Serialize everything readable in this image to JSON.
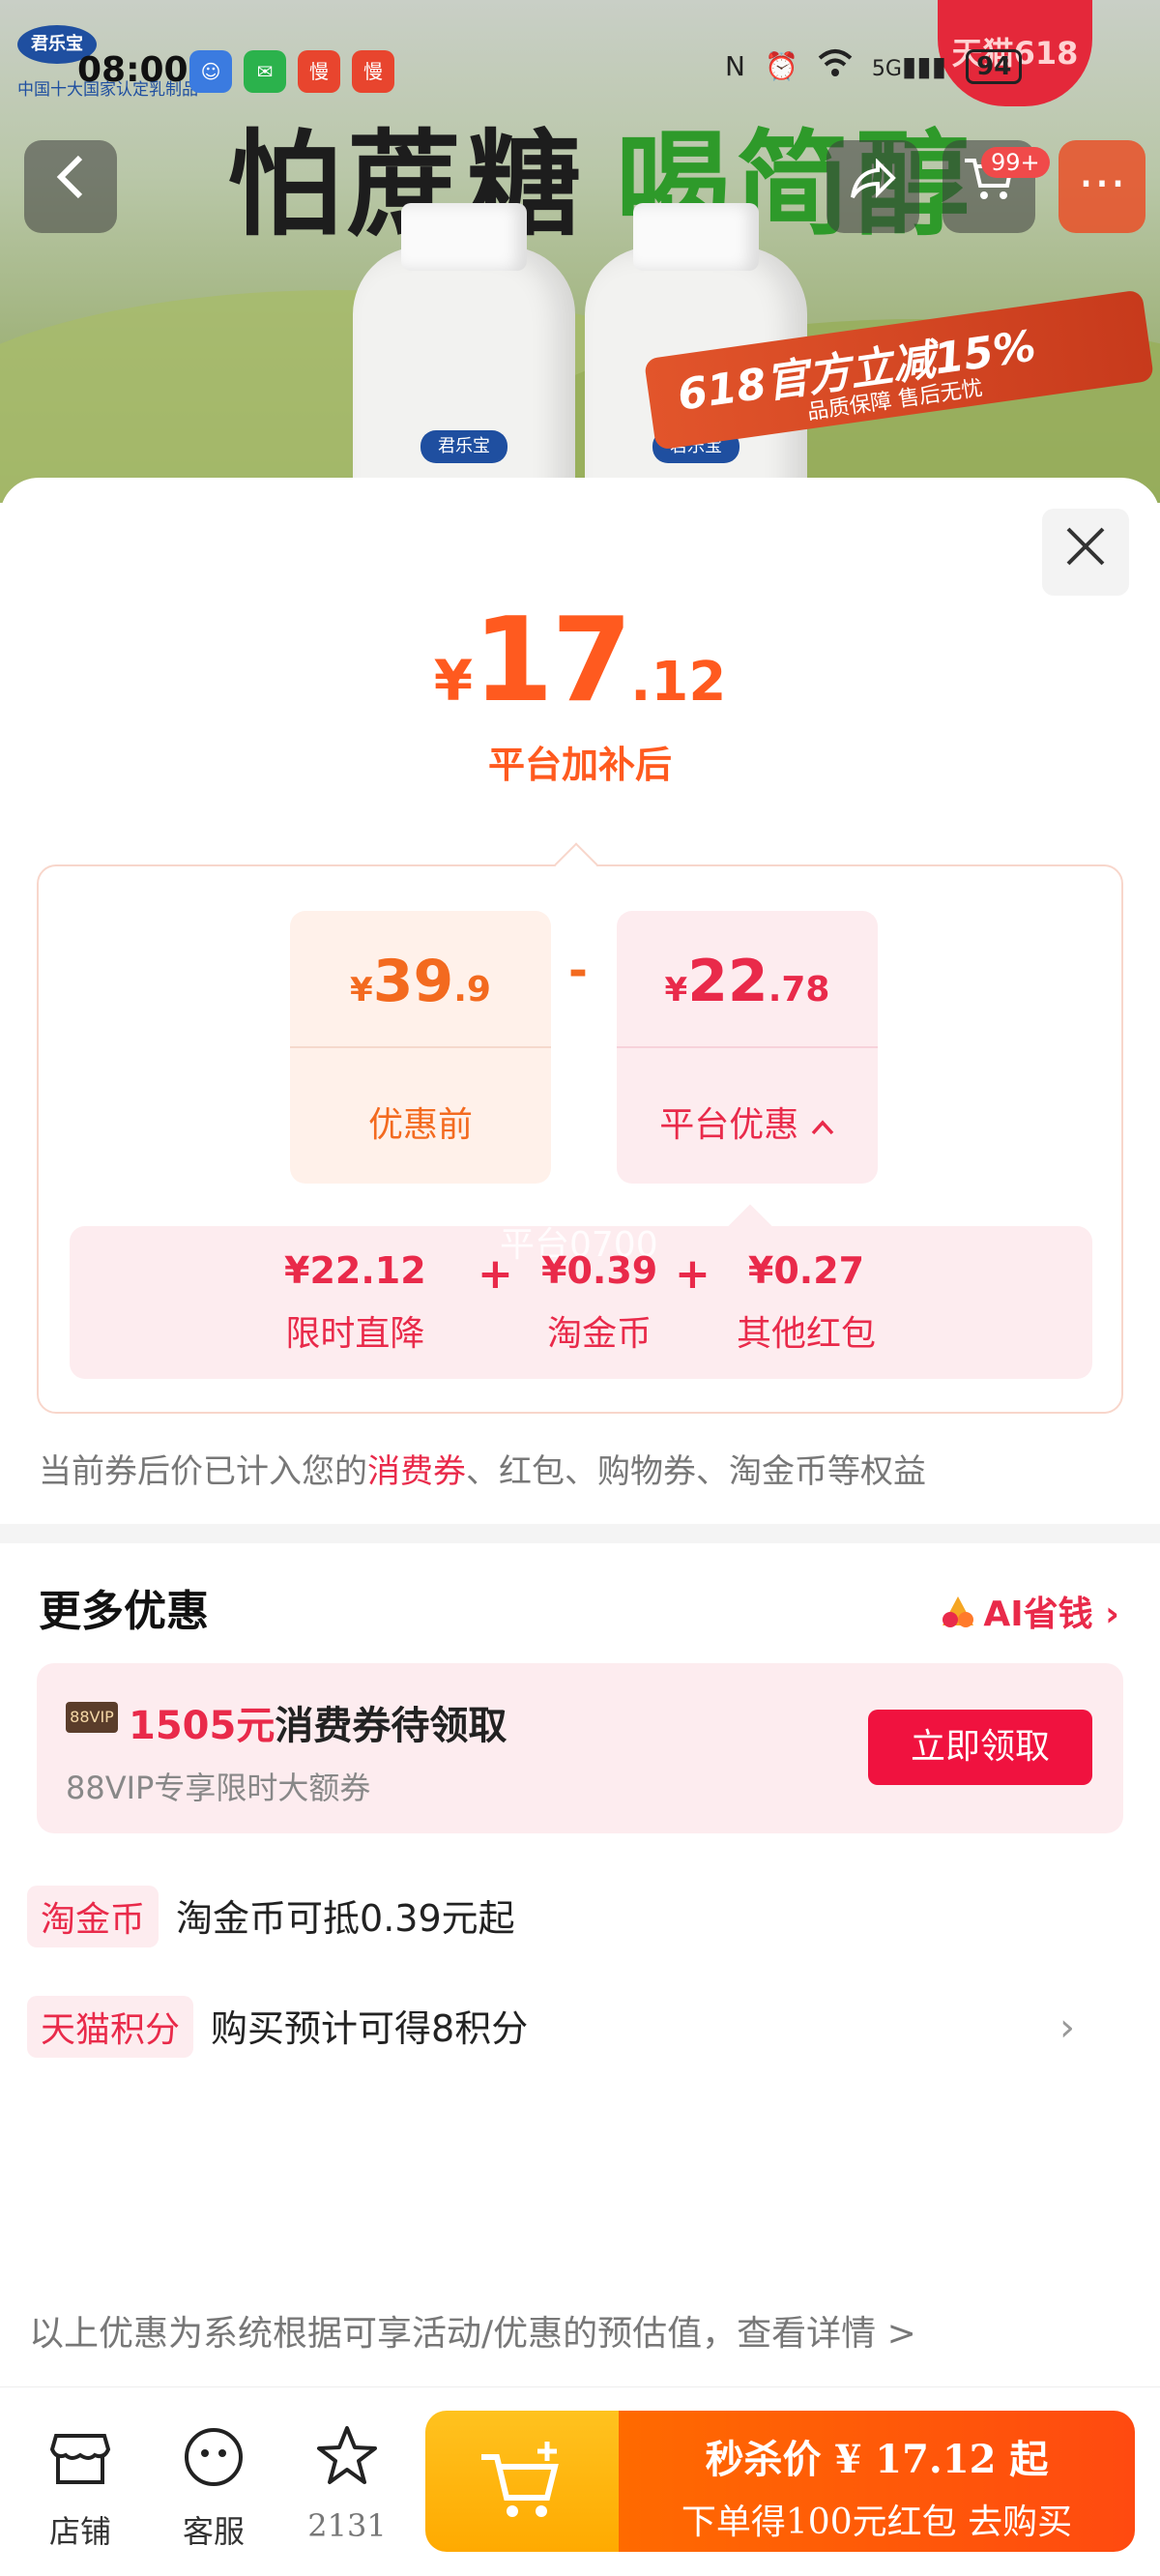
{
  "status_bar": {
    "time": "08:00",
    "battery": "94",
    "network": "5G"
  },
  "banner": {
    "brand": "君乐宝",
    "brand_sub": "中国十大国家认定乳制品",
    "headline_dark": "怕蔗糖",
    "headline_green": "喝简醇",
    "promo_big": "618官方立减15%",
    "promo_small": "品质保障 售后无忧",
    "tmall_badge": "天猫618",
    "cart_badge": "99+"
  },
  "final_price": {
    "currency": "¥",
    "integer": "17",
    "decimal": ".12",
    "caption": "平台加补后"
  },
  "breakdown": {
    "original": {
      "currency": "¥",
      "integer": "39",
      "decimal": ".9",
      "label": "优惠前"
    },
    "minus": "-",
    "discount": {
      "currency": "¥",
      "integer": "22",
      "decimal": ".78",
      "label": "平台优惠"
    },
    "watermark": "平台0700",
    "items": [
      {
        "amount": "¥22.12",
        "name": "限时直降"
      },
      {
        "amount": "¥0.39",
        "name": "淘金币"
      },
      {
        "amount": "¥0.27",
        "name": "其他红包"
      }
    ],
    "plus": "+"
  },
  "note": {
    "prefix": "当前券后价已计入您的",
    "highlight": "消费券",
    "suffix": "、红包、购物券、淘金币等权益"
  },
  "more": {
    "title": "更多优惠",
    "ai_label": "AI省钱",
    "vip": {
      "badge": "88VIP",
      "amount": "1505元",
      "text": "消费券待领取",
      "subtitle": "88VIP专享限时大额券",
      "button": "立即领取"
    },
    "rows": [
      {
        "tag": "淘金币",
        "text": "淘金币可抵0.39元起"
      },
      {
        "tag": "天猫积分",
        "text": "购买预计可得8积分"
      }
    ]
  },
  "disclaimer": "以上优惠为系统根据可享活动/优惠的预估值，查看详情 >",
  "bottom_bar": {
    "shop": "店铺",
    "service": "客服",
    "favorites": "2131",
    "buy_line1": "秒杀价 ¥ 17.12 起",
    "buy_line2": "下单得100元红包 去购买"
  },
  "colors": {
    "accent_orange": "#ff5a1f",
    "accent_red": "#e92a4a",
    "buy_orange": "#ff6a00",
    "cart_yellow": "#ffb400"
  }
}
